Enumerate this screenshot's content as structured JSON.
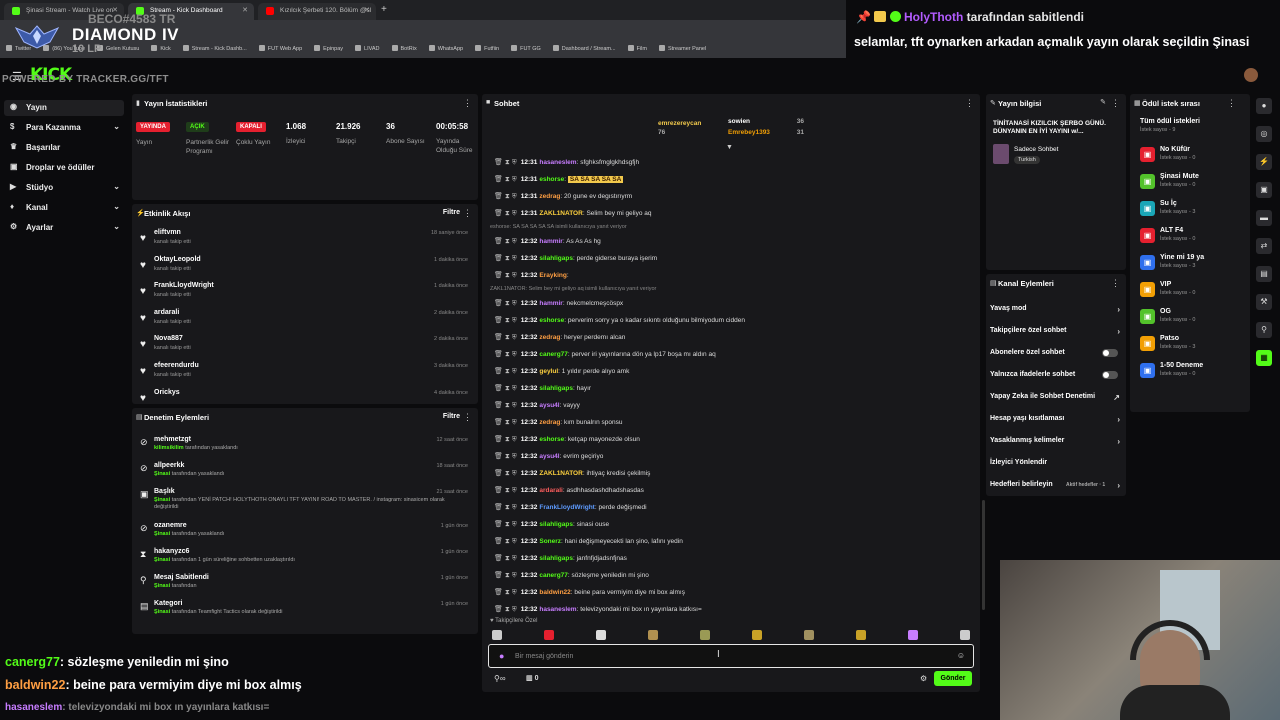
{
  "browser": {
    "tabs": [
      {
        "label": "Şinasi Stream - Watch Live on"
      },
      {
        "label": "Stream - Kick Dashboard"
      },
      {
        "label": "Kızılcık Şerbeti 120. Bölüm @sl"
      }
    ],
    "new_tab": "+",
    "bookmarks": [
      "Twitter",
      "(86) YouTube",
      "Gelen Kutusu",
      "Kick",
      "Stream - Kick Dashb...",
      "FUT Web App",
      "Epinpay",
      "LIVAD",
      "BotRix",
      "WhatsApp",
      "Futfiin",
      "FUT GG",
      "Dashboard / Stream...",
      "Film",
      "Streamer Panel"
    ]
  },
  "overlay": {
    "rank_id": "BECO#4583 TR",
    "rank_title": "DIAMOND IV",
    "rank_lp": "10 LP",
    "powered_by": "POWERED BY TRACKER.GG/TFT"
  },
  "kick": {
    "logo": "KICK"
  },
  "pinned": {
    "user": "HolyThoth",
    "suffix": "tarafından sabitlendi",
    "message": "selamlar, tft oynarken arkadan açmalık yayın olarak seçildin Şinasi"
  },
  "sidebar": {
    "items": [
      {
        "label": "Yayın",
        "icon": "broadcast-icon"
      },
      {
        "label": "Para Kazanma",
        "icon": "money-icon"
      },
      {
        "label": "Başarılar",
        "icon": "trophy-icon"
      },
      {
        "label": "Droplar ve ödüller",
        "icon": "gift-icon"
      },
      {
        "label": "Stüdyo",
        "icon": "studio-icon"
      },
      {
        "label": "Kanal",
        "icon": "channel-icon"
      },
      {
        "label": "Ayarlar",
        "icon": "gear-icon"
      }
    ]
  },
  "stats": {
    "title": "Yayın İstatistikleri",
    "items": [
      {
        "badge": "YAYINDA",
        "label": "Yayın",
        "color": "#e5202f"
      },
      {
        "badge": "AÇIK",
        "label": "Partnerlik Gelir Programı",
        "color": "#2ea043"
      },
      {
        "badge": "KAPALI",
        "label": "Çoklu Yayın",
        "color": "#e5202f"
      },
      {
        "value": "1.068",
        "label": "İzleyici"
      },
      {
        "value": "21.926",
        "label": "Takipçi"
      },
      {
        "value": "36",
        "label": "Abone Sayısı"
      },
      {
        "value": "00:05:58",
        "label": "Yayında Olduğu Süre"
      }
    ]
  },
  "activity": {
    "title": "Etkinlik Akışı",
    "filter": "Filtre",
    "items": [
      {
        "name": "eliftvmn",
        "sub": "kanalı takip etti",
        "time": "18 saniye önce"
      },
      {
        "name": "OktayLeopold",
        "sub": "kanalı takip etti",
        "time": "1 dakika önce"
      },
      {
        "name": "FrankLloydWright",
        "sub": "kanalı takip etti",
        "time": "1 dakika önce"
      },
      {
        "name": "ardarali",
        "sub": "kanalı takip etti",
        "time": "2 dakika önce"
      },
      {
        "name": "Nova887",
        "sub": "kanalı takip etti",
        "time": "2 dakika önce"
      },
      {
        "name": "efeerendurdu",
        "sub": "kanalı takip etti",
        "time": "3 dakika önce"
      },
      {
        "name": "Orickys",
        "sub": "",
        "time": "4 dakika önce"
      }
    ]
  },
  "moderation": {
    "title": "Denetim Eylemleri",
    "filter": "Filtre",
    "items": [
      {
        "name": "mehmetzgt",
        "actor": "kilimsikilim",
        "text": "tarafından yasaklandı",
        "time": "12 saat önce",
        "icon": "ban-icon"
      },
      {
        "name": "allpeerkk",
        "actor": "Şinasi",
        "text": "tarafından yasaklandı",
        "time": "18 saat önce",
        "icon": "ban-icon"
      },
      {
        "name": "Başlık",
        "actor": "Şinasi",
        "text": "tarafından YENİ PATCH! HOLYTHOTH ONAYLI TFT YAYINI! ROAD TO MASTER. / instagram: sinasicem olarak değiştirildi",
        "time": "21 saat önce",
        "icon": "title-icon"
      },
      {
        "name": "ozanemre",
        "actor": "Şinasi",
        "text": "tarafından yasaklandı",
        "time": "1 gün önce",
        "icon": "ban-icon"
      },
      {
        "name": "hakanyzc6",
        "actor": "Şinasi",
        "text": "tarafından 1 gün süreliğine sohbetten uzaklaştırıldı",
        "time": "1 gün önce",
        "icon": "timeout-icon"
      },
      {
        "name": "Mesaj Sabitlendi",
        "actor": "Şinasi",
        "text": "tarafından",
        "time": "1 gün önce",
        "icon": "pin-icon"
      },
      {
        "name": "Kategori",
        "actor": "Şinasi",
        "text": "tarafından Teamfight Tactics olarak değiştirildi",
        "time": "1 gün önce",
        "icon": "category-icon"
      }
    ]
  },
  "chat": {
    "title": "Sohbet",
    "top_gifters": [
      {
        "name": "emrezereycan",
        "count": "76"
      },
      {
        "name": "sowien",
        "count": "36"
      },
      {
        "name": "Emrebey1393",
        "count": "31"
      }
    ],
    "messages": [
      {
        "time": "12:31",
        "user": "hasaneslem",
        "color": "#c77dff",
        "text": "sfghksfmglgkhdsgfjh"
      },
      {
        "time": "12:31",
        "user": "eshorse",
        "color": "#53fc18",
        "text": "SA SA SA SA SA"
      },
      {
        "time": "12:31",
        "user": "zedrag",
        "color": "#ff9f43",
        "text": "20 gune ev degıstırıyrm"
      },
      {
        "time": "12:31",
        "user": "ZAKL1NATOR",
        "color": "#ffd23f",
        "text": "Selim bey mi geliyo aq"
      },
      {
        "reply": "eshorse: SA SA SA SA SA isimli kullanıcıya yanıt veriyor"
      },
      {
        "time": "12:32",
        "user": "hammir",
        "color": "#c77dff",
        "text": "As As As hg"
      },
      {
        "time": "12:32",
        "user": "silahligaps",
        "color": "#53fc18",
        "text": "perde gidersе buraya işerim"
      },
      {
        "time": "12:32",
        "user": "Erayking",
        "color": "#ff9f43",
        "text": ""
      },
      {
        "reply": "ZAKL1NATOR: Selim bey mi geliyo aq isimli kullanıcıya yanıt veriyor"
      },
      {
        "time": "12:32",
        "user": "hammir",
        "color": "#c77dff",
        "text": "nekcmelcmeşcöspx"
      },
      {
        "time": "12:32",
        "user": "eshorse",
        "color": "#53fc18",
        "text": "perverim sorry ya o kadar sıkıntı olduğunu bilmiyodum cidden"
      },
      {
        "time": "12:32",
        "user": "zedrag",
        "color": "#ff9f43",
        "text": "heryer perdemı alcan"
      },
      {
        "time": "12:32",
        "user": "canerg77",
        "color": "#53fc18",
        "text": "perver iri yayınlarına dön ya lp17 boşa mı aldın aq"
      },
      {
        "time": "12:32",
        "user": "geylul",
        "color": "#ffd23f",
        "text": "1 yıldır perde alıyo amk"
      },
      {
        "time": "12:32",
        "user": "silahligaps",
        "color": "#53fc18",
        "text": "hayır"
      },
      {
        "time": "12:32",
        "user": "aysu4l",
        "color": "#c77dff",
        "text": "vayyy"
      },
      {
        "time": "12:32",
        "user": "zedrag",
        "color": "#ff9f43",
        "text": "kım bunalrın sponsu"
      },
      {
        "time": "12:32",
        "user": "eshorse",
        "color": "#53fc18",
        "text": "ketçap mayonezde olsun"
      },
      {
        "time": "12:32",
        "user": "aysu4l",
        "color": "#c77dff",
        "text": "evrim geçiriyo"
      },
      {
        "time": "12:32",
        "user": "ZAKL1NATOR",
        "color": "#ffd23f",
        "text": "ihtiyaç kredisi çekilmiş"
      },
      {
        "time": "12:32",
        "user": "ardarali",
        "color": "#ff5e5e",
        "text": "asdhhasdashdhadshasdas"
      },
      {
        "time": "12:32",
        "user": "FrankLloydWright",
        "color": "#5e9bff",
        "text": "perde değişmedi"
      },
      {
        "time": "12:32",
        "user": "silahligaps",
        "color": "#53fc18",
        "text": "sinasi ouse"
      },
      {
        "time": "12:32",
        "user": "Sonerz",
        "color": "#53fc18",
        "text": "hani değişmeyecekti lan şino, lafını yedin"
      },
      {
        "time": "12:32",
        "user": "silahligaps",
        "color": "#53fc18",
        "text": "janfnfjdjadsnfjnas"
      },
      {
        "time": "12:32",
        "user": "canerg77",
        "color": "#53fc18",
        "text": "sözleşme yeniledin mi şino"
      },
      {
        "time": "12:32",
        "user": "baldwin22",
        "color": "#ff9f43",
        "text": "beine para vermiyim diye mi box almış"
      },
      {
        "time": "12:32",
        "user": "hasaneslem",
        "color": "#c77dff",
        "text": "televizyondaki mi box ın yayınlara katkısı="
      }
    ],
    "followers_only": "Takipçilere Özel",
    "input_placeholder": "Bir mesaj gönderin",
    "pause_count": "0",
    "send_label": "Gönder"
  },
  "stream_info": {
    "title": "Yayın bilgisi",
    "stream_title": "TİNİTANASİ KIZILCIK ŞERBO GÜNÜ. DÜNYANIN EN İYİ YAYINI w/...",
    "category": "Sadece Sohbet",
    "tag": "Turkish"
  },
  "channel_actions": {
    "title": "Kanal Eylemleri",
    "items": [
      {
        "label": "Yavaş mod",
        "type": "chevron"
      },
      {
        "label": "Takipçilere özel sohbet",
        "type": "chevron"
      },
      {
        "label": "Abonelere özel sohbet",
        "type": "toggle"
      },
      {
        "label": "Yalnızca ifadelerle sohbet",
        "type": "toggle"
      },
      {
        "label": "Yapay Zeka ile Sohbet Denetimi",
        "type": "external"
      },
      {
        "label": "Hesap yaşı kısıtlaması",
        "type": "chevron"
      },
      {
        "label": "Yasaklanmış kelimeler",
        "type": "chevron"
      },
      {
        "label": "İzleyici Yönlendir",
        "type": "none"
      },
      {
        "label": "Hedefleri belirleyin",
        "type": "goal",
        "extra": "Aktif hedefler · 1"
      }
    ]
  },
  "rewards": {
    "title": "Ödül istek sırası",
    "items": [
      {
        "name": "Tüm ödül istekleri",
        "sub": "İstek sayısı - 9",
        "color": ""
      },
      {
        "name": "No Küfür",
        "sub": "İstek sayısı - 0",
        "color": "#e5202f"
      },
      {
        "name": "Şinasi Mute",
        "sub": "İstek sayısı - 0",
        "color": "#53c22b"
      },
      {
        "name": "Su İç",
        "sub": "İstek sayısı - 3",
        "color": "#1aa6b7"
      },
      {
        "name": "ALT F4",
        "sub": "İstek sayısı - 0",
        "color": "#e5202f"
      },
      {
        "name": "Yine mi 19 ya",
        "sub": "İstek sayısı - 3",
        "color": "#2f6fed"
      },
      {
        "name": "VIP",
        "sub": "İstek sayısı - 0",
        "color": "#f29f05"
      },
      {
        "name": "OG",
        "sub": "İstek sayısı - 0",
        "color": "#53c22b"
      },
      {
        "name": "Patso",
        "sub": "İstek sayısı - 3",
        "color": "#f29f05"
      },
      {
        "name": "1-50 Deneme",
        "sub": "İstek sayısı - 0",
        "color": "#2f6fed"
      }
    ]
  },
  "bottom_overlay": {
    "lines": [
      {
        "user": "canerg77",
        "text": ": sözleşme yeniledin mi şino",
        "color": "#53fc18"
      },
      {
        "user": "baldwin22",
        "text": ": beine para vermiyim diye mi box almış",
        "color": "#ff9f43"
      },
      {
        "user": "hasaneslem",
        "text": ": televizyondaki mi box ın yayınlara katkısı=",
        "color": "#c77dff"
      }
    ]
  },
  "colors": {
    "kick_green": "#53fc18",
    "panel": "#18181b",
    "bg": "#0b0b0d",
    "live_red": "#e5202f"
  }
}
